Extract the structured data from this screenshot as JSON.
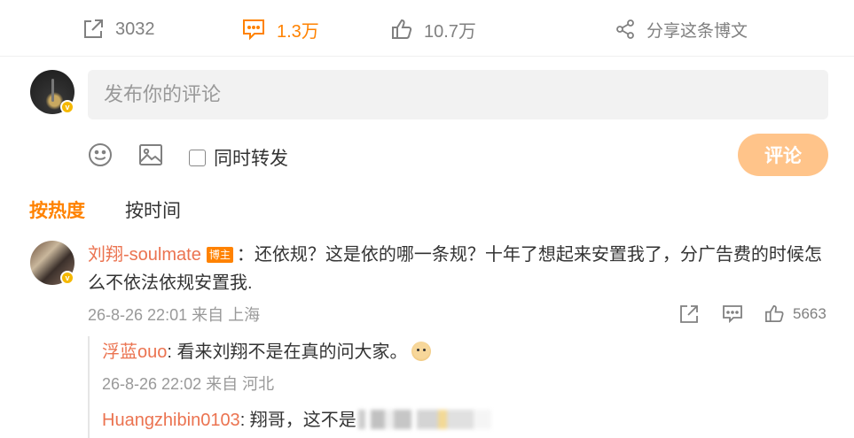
{
  "actions": {
    "forward_count": "3032",
    "comment_count": "1.3万",
    "like_count": "10.7万",
    "share_label": "分享这条博文"
  },
  "compose": {
    "placeholder": "发布你的评论",
    "repost_label": "同时转发",
    "submit_label": "评论"
  },
  "sort_tabs": {
    "hot": "按热度",
    "time": "按时间"
  },
  "comment": {
    "username": "刘翔-soulmate",
    "badge": "博主",
    "separator": "：",
    "text": "还依规？这是依的哪一条规？十年了想起来安置我了，分广告费的时候怎么不依法依规安置我.",
    "timestamp": "26-8-26 22:01",
    "location": "来自 上海",
    "like_count": "5663"
  },
  "replies": [
    {
      "username": "浮蓝ouo",
      "text": ": 看来刘翔不是在真的问大家。",
      "emoji": "doge-emoji",
      "timestamp": "26-8-26 22:02",
      "location": "来自 河北"
    },
    {
      "username": "Huangzhibin0103",
      "text": ": 翔哥，这不是"
    }
  ],
  "colors": {
    "accent": "#ff8200",
    "username": "#eb7350",
    "button_disabled": "#ffc48a",
    "muted": "#999999"
  },
  "icons": [
    "forward-icon",
    "comment-icon",
    "like-icon",
    "share-icon",
    "emoji-icon",
    "image-icon",
    "verified-badge-icon"
  ]
}
